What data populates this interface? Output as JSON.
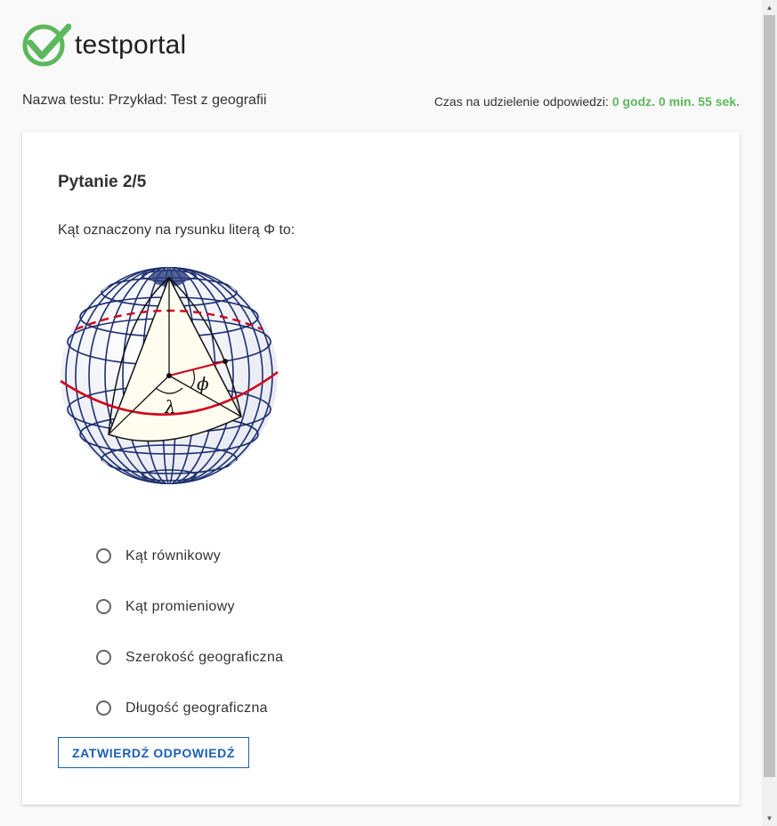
{
  "brand": {
    "name": "testportal"
  },
  "test_info": {
    "name_label": "Nazwa testu: Przykład: Test z geografii",
    "time_label": "Czas na udzielenie odpowiedzi:",
    "time_value": "0 godz. 0 min. 55 sek."
  },
  "question": {
    "title": "Pytanie 2/5",
    "text": "Kąt oznaczony na rysunku literą Φ to:",
    "figure_symbols": {
      "phi": "ϕ",
      "lambda": "λ"
    },
    "answers": [
      {
        "label": "Kąt równikowy",
        "selected": false
      },
      {
        "label": "Kąt promieniowy",
        "selected": false
      },
      {
        "label": "Szerokość geograficzna",
        "selected": false
      },
      {
        "label": "Długość geograficzna",
        "selected": false
      }
    ],
    "submit_label": "ZATWIERDŹ ODPOWIEDŹ"
  },
  "colors": {
    "accent_green": "#5cb85c",
    "button_blue": "#1a5fb4",
    "equator_red": "#d0021b",
    "grid_blue": "#1c2f6e"
  }
}
